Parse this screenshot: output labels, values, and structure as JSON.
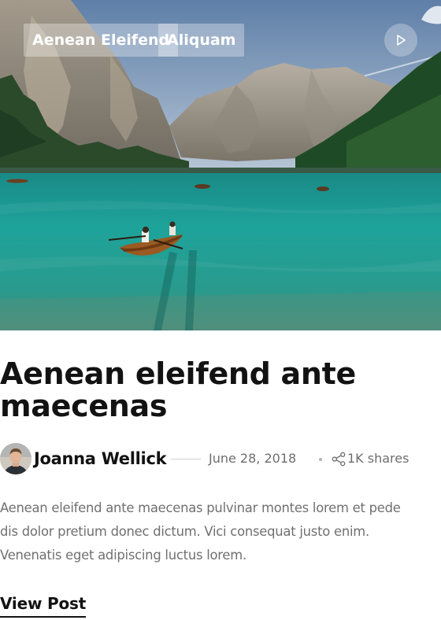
{
  "hero": {
    "tags": [
      "Aenean Eleifend",
      "Aliquam"
    ],
    "play_icon": "play-icon"
  },
  "post": {
    "title_line1": "Aenean eleifend ante",
    "title_line2": "maecenas",
    "author": "Joanna Wellick",
    "date": "June 28, 2018",
    "shares": "1K shares",
    "share_icon": "share-icon",
    "excerpt_line1": "Aenean eleifend ante maecenas pulvinar montes lorem et pede",
    "excerpt_line2": "dis dolor pretium donec dictum. Vici consequat justo enim.",
    "excerpt_line3": "Venenatis eget adipiscing luctus lorem.",
    "view_label": "View Post"
  }
}
